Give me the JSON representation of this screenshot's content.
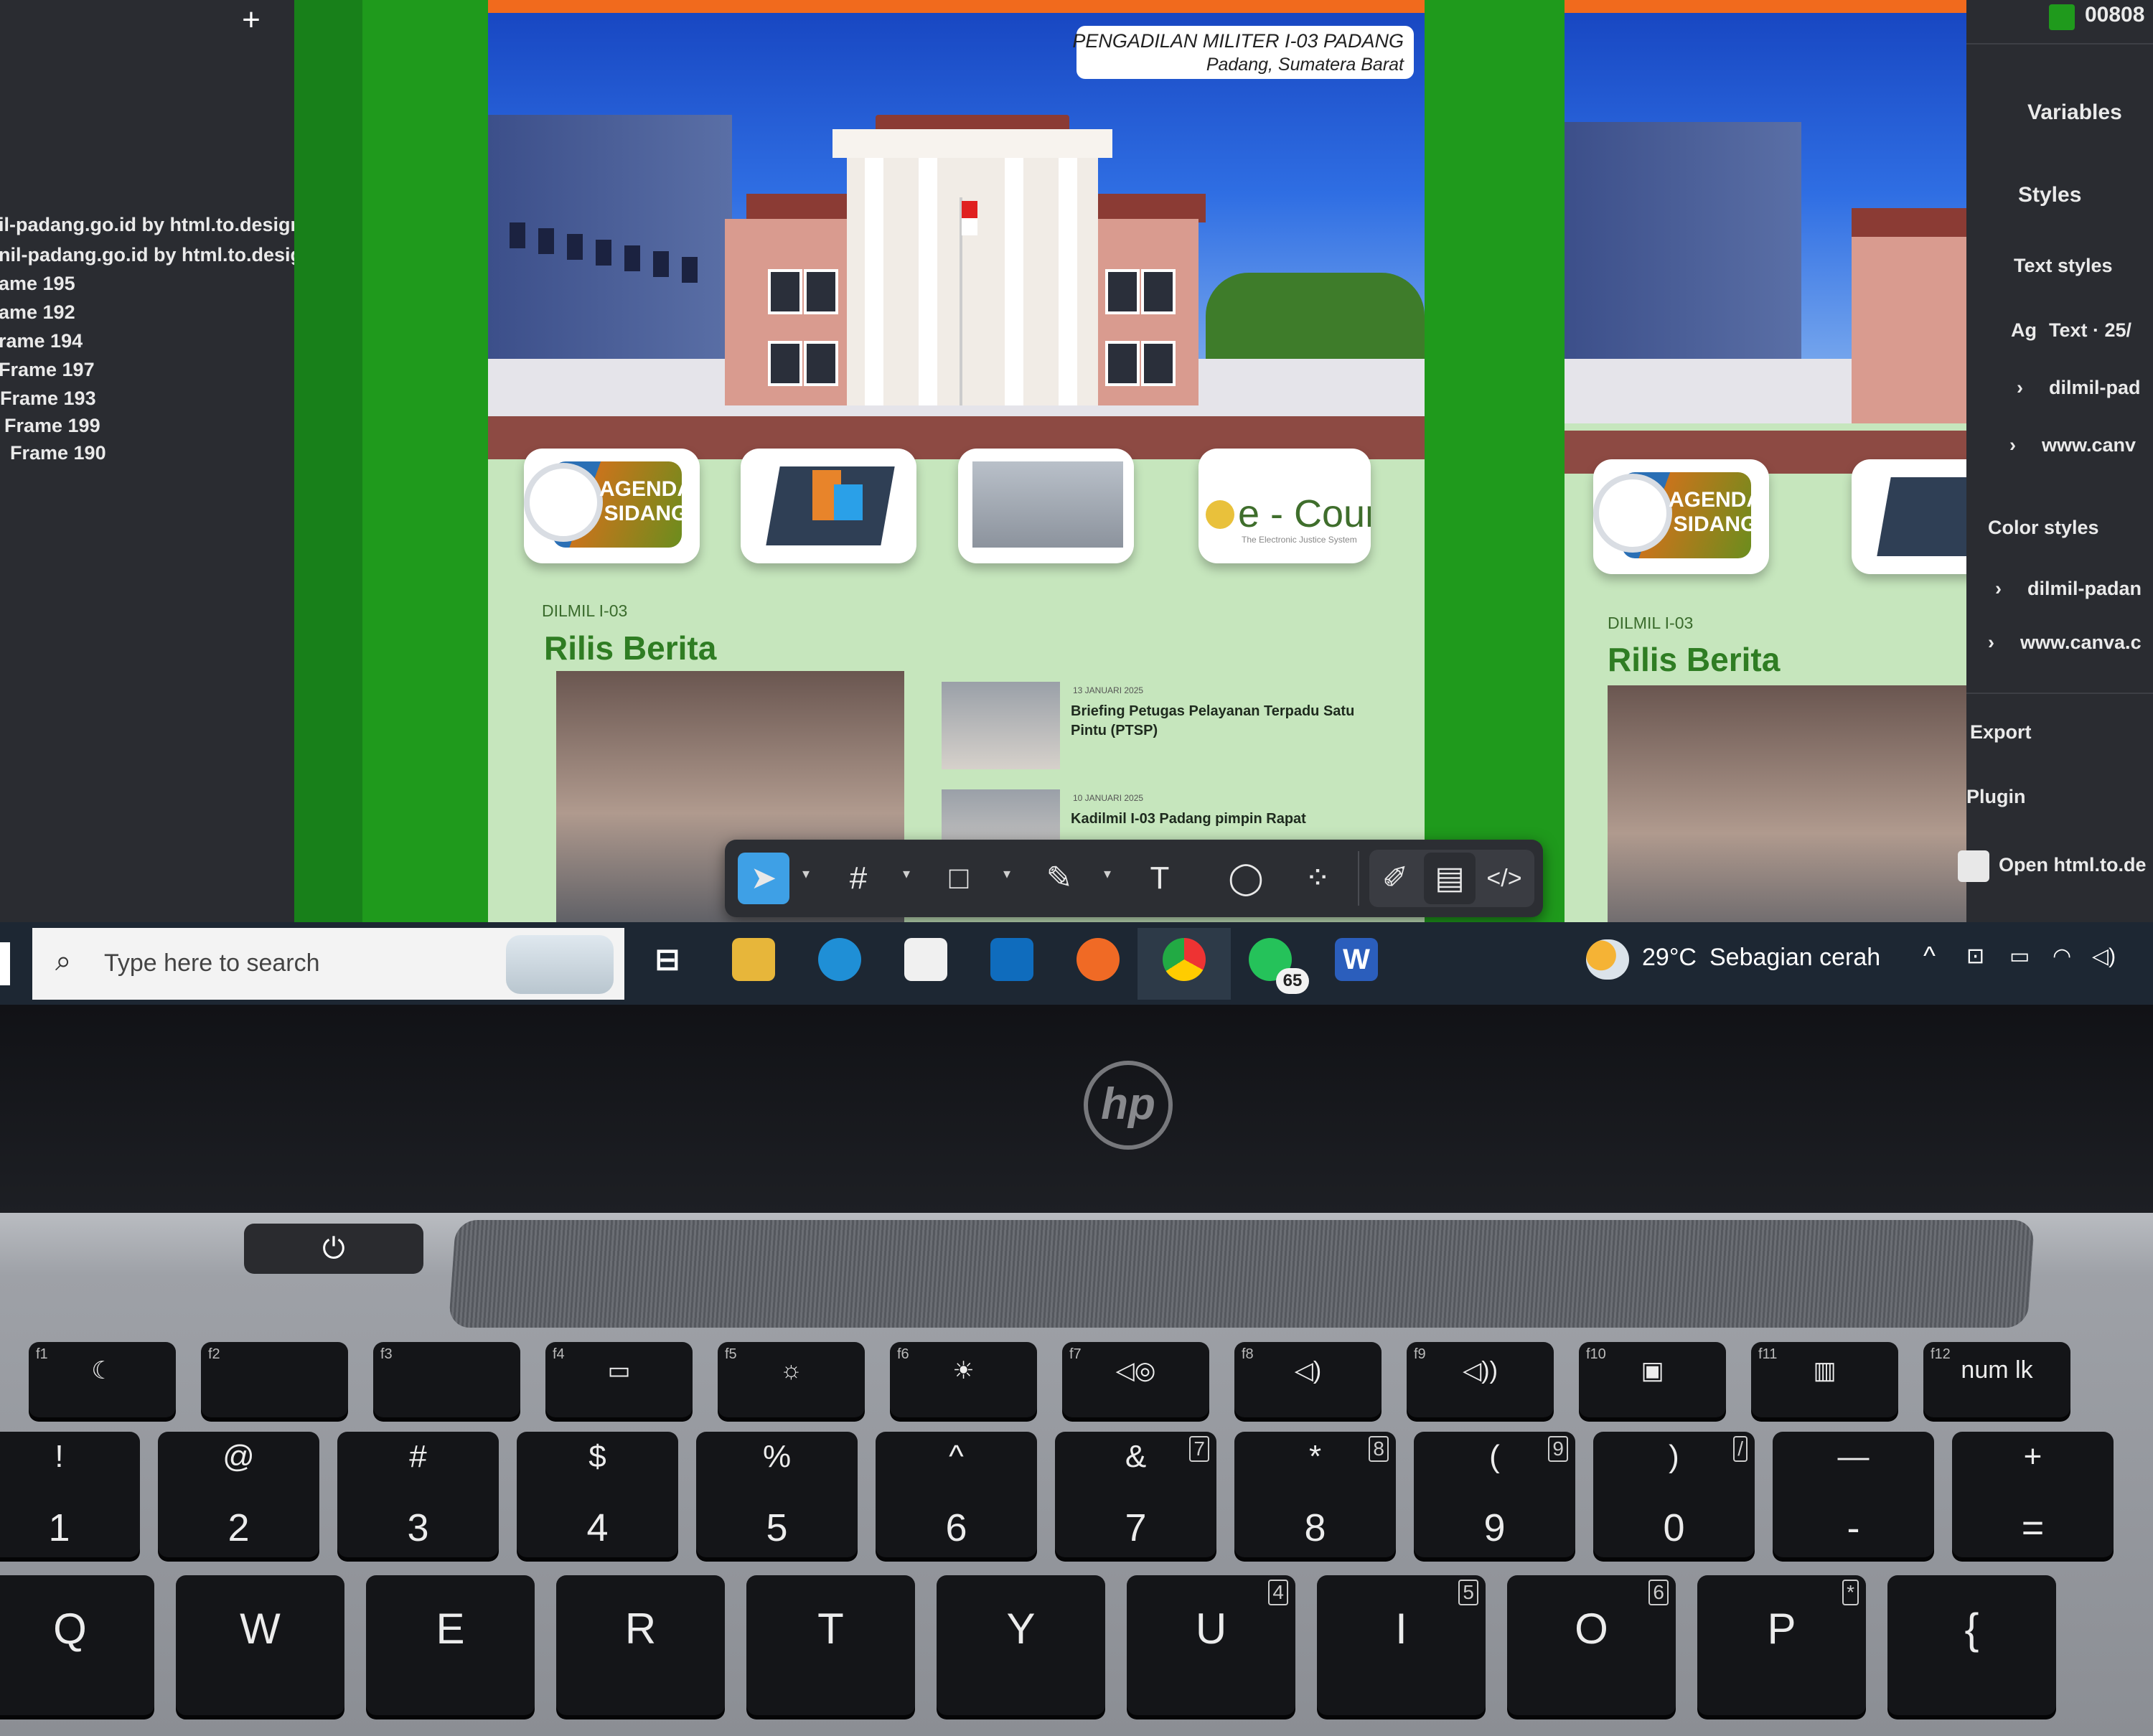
{
  "layers_panel": {
    "add_symbol": "+",
    "items": [
      "il-padang.go.id by html.to.design",
      "nil-padang.go.id by html.to.design",
      "ame 195",
      "ame 192",
      "rame 194",
      "Frame 197",
      "Frame 193",
      "Frame 199",
      "Frame 190"
    ]
  },
  "frame1": {
    "title_line1": "PENGADILAN MILITER I-03 PADANG",
    "title_line2": "Padang, Sumatera Barat",
    "agenda_label": "AGENDA\nSIDANG",
    "ecourt_label": "e - Court",
    "ecourt_sub": "The Electronic Justice System",
    "kicker": "DILMIL I-03",
    "heading": "Rilis Berita",
    "news": [
      {
        "date": "13 JANUARI 2025",
        "title": "Briefing Petugas Pelayanan Terpadu Satu Pintu (PTSP)"
      },
      {
        "date": "10 JANUARI 2025",
        "title": "Kadilmil I-03 Padang pimpin Rapat"
      }
    ]
  },
  "frame2": {
    "agenda_label": "AGENDA\nSIDANG",
    "kicker": "DILMIL I-03",
    "heading": "Rilis Berita"
  },
  "toolbar": {
    "tools": [
      "move-tool",
      "frame-tool",
      "shape-tool",
      "pen-tool",
      "text-tool",
      "comment-tool",
      "actions-tool",
      "draw-mode",
      "design-mode",
      "dev-mode"
    ],
    "text_tool_glyph": "T"
  },
  "props_panel": {
    "top_value": "00808",
    "variables": "Variables",
    "styles": "Styles",
    "text_styles": "Text styles",
    "text_style_prefix": "Ag",
    "text_style_item": "Text · 25/",
    "text_style_children": [
      "dilmil-pad",
      "www.canv"
    ],
    "color_styles": "Color styles",
    "color_style_children": [
      "dilmil-padan",
      "www.canva.c"
    ],
    "export": "Export",
    "plugin": "Plugin",
    "plugin_item": "Open html.to.de"
  },
  "taskbar": {
    "search_placeholder": "Type here to search",
    "whatsapp_badge": "65",
    "word_label": "W",
    "weather_temp": "29°C",
    "weather_text": "Sebagian cerah"
  },
  "laptop": {
    "logo": "hp",
    "fn_keys": [
      {
        "fn": "f1",
        "icon": "☾"
      },
      {
        "fn": "f2",
        "icon": ""
      },
      {
        "fn": "f3",
        "icon": ""
      },
      {
        "fn": "f4",
        "icon": "▭"
      },
      {
        "fn": "f5",
        "icon": "☼"
      },
      {
        "fn": "f6",
        "icon": "☀"
      },
      {
        "fn": "f7",
        "icon": "◁◎"
      },
      {
        "fn": "f8",
        "icon": "◁)"
      },
      {
        "fn": "f9",
        "icon": "◁))"
      },
      {
        "fn": "f10",
        "icon": "▣"
      },
      {
        "fn": "f11",
        "icon": "▥"
      },
      {
        "fn": "f12",
        "icon": "num lk"
      }
    ],
    "number_row": [
      {
        "top": "!",
        "bot": "1"
      },
      {
        "top": "@",
        "bot": "2"
      },
      {
        "top": "#",
        "bot": "3"
      },
      {
        "top": "$",
        "bot": "4"
      },
      {
        "top": "%",
        "bot": "5"
      },
      {
        "top": "^",
        "bot": "6"
      },
      {
        "top": "&",
        "bot": "7",
        "alt": "7"
      },
      {
        "top": "*",
        "bot": "8",
        "alt": "8"
      },
      {
        "top": "(",
        "bot": "9",
        "alt": "9"
      },
      {
        "top": ")",
        "bot": "0",
        "alt": "/"
      },
      {
        "top": "—",
        "bot": "-"
      },
      {
        "top": "+",
        "bot": "="
      }
    ],
    "letter_row": [
      {
        "bot": "Q"
      },
      {
        "bot": "W"
      },
      {
        "bot": "E"
      },
      {
        "bot": "R"
      },
      {
        "bot": "T"
      },
      {
        "bot": "Y"
      },
      {
        "bot": "U",
        "alt": "4"
      },
      {
        "bot": "I",
        "alt": "5"
      },
      {
        "bot": "O",
        "alt": "6"
      },
      {
        "bot": "P",
        "alt": "*"
      },
      {
        "bot": "{"
      }
    ]
  },
  "colors": {
    "canvas_green": "#1f9a1c",
    "heading_green": "#2f7d23",
    "toolbar_active": "#3ea0e6",
    "orange_bar": "#f16a1d"
  }
}
